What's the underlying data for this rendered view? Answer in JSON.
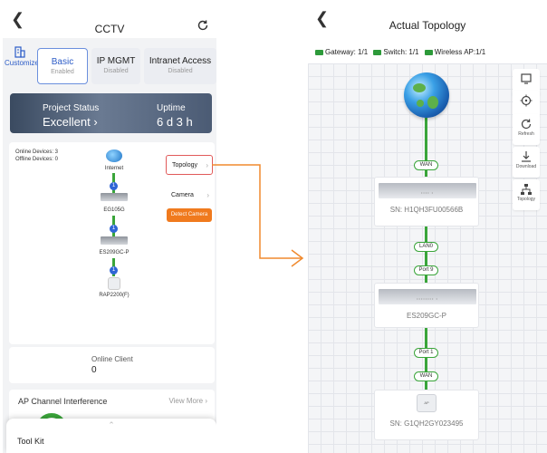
{
  "left": {
    "title": "CCTV",
    "tabs": {
      "customize": "Customize",
      "basic": {
        "label": "Basic",
        "state": "Enabled"
      },
      "ipmgmt": {
        "label": "IP MGMT",
        "state": "Disabled"
      },
      "intranet": {
        "label": "Intranet Access",
        "state": "Disabled"
      }
    },
    "project_status": {
      "label": "Project Status",
      "value": "Excellent"
    },
    "uptime": {
      "label": "Uptime",
      "value": "6 d 3 h"
    },
    "counts": {
      "online": "Online Devices: 3",
      "offline": "Offline Devices: 0"
    },
    "mini_topology": {
      "internet_label": "Internet",
      "nodes": [
        "EG105G",
        "ES209GC-P",
        "RAP2200(F)"
      ],
      "badges": [
        "1",
        "1",
        "1",
        "1"
      ]
    },
    "side_buttons": {
      "topology": "Topology",
      "camera": "Camera",
      "detect_camera": "Detect Camera"
    },
    "online_client": {
      "label": "Online Client",
      "value": "0"
    },
    "ap_interference": {
      "label": "AP Channel Interference",
      "more": "View More"
    },
    "toolkit": "Tool Kit"
  },
  "right": {
    "title": "Actual Topology",
    "legend": [
      "Gateway: 1/1",
      "Switch: 1/1",
      "Wireless AP:1/1"
    ],
    "links": {
      "wan1": "WAN",
      "lan": "LAN0",
      "port9": "Port 9",
      "port1": "Port 1",
      "wan2": "WAN"
    },
    "devices": {
      "gateway": {
        "sn": "SN:  H1QH3FU00566B"
      },
      "switch": {
        "name": "ES209GC-P"
      },
      "ap": {
        "sn": "SN:  G1QH2GY023495",
        "badge": "AP"
      }
    },
    "toolbar": {
      "refresh": "Refresh",
      "download": "Download",
      "topology": "Topology"
    }
  },
  "colors": {
    "accent": "#2c5cc7",
    "link": "#3aa53a",
    "highlight": "#e15a5a",
    "arrow": "#f08a2e"
  }
}
